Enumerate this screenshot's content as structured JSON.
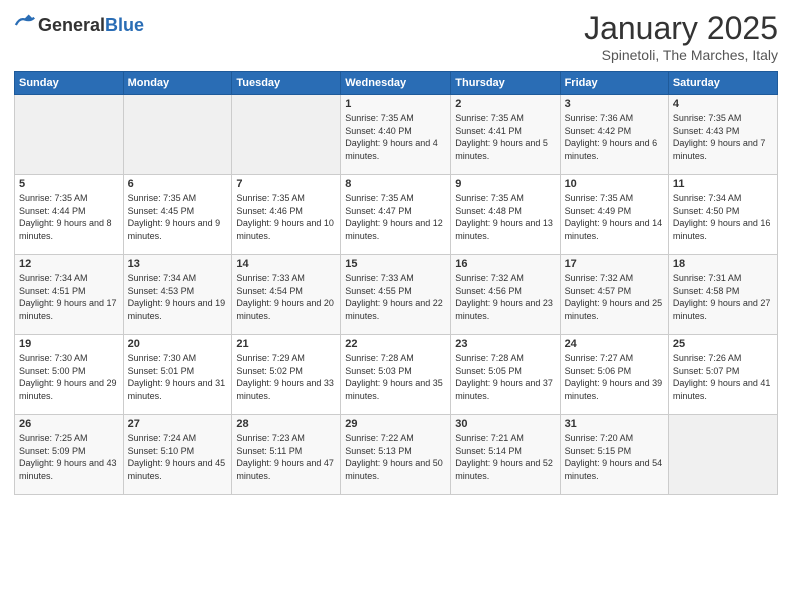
{
  "logo": {
    "general": "General",
    "blue": "Blue"
  },
  "title": "January 2025",
  "subtitle": "Spinetoli, The Marches, Italy",
  "days_of_week": [
    "Sunday",
    "Monday",
    "Tuesday",
    "Wednesday",
    "Thursday",
    "Friday",
    "Saturday"
  ],
  "weeks": [
    [
      {
        "day": "",
        "info": ""
      },
      {
        "day": "",
        "info": ""
      },
      {
        "day": "",
        "info": ""
      },
      {
        "day": "1",
        "info": "Sunrise: 7:35 AM\nSunset: 4:40 PM\nDaylight: 9 hours and 4 minutes."
      },
      {
        "day": "2",
        "info": "Sunrise: 7:35 AM\nSunset: 4:41 PM\nDaylight: 9 hours and 5 minutes."
      },
      {
        "day": "3",
        "info": "Sunrise: 7:36 AM\nSunset: 4:42 PM\nDaylight: 9 hours and 6 minutes."
      },
      {
        "day": "4",
        "info": "Sunrise: 7:35 AM\nSunset: 4:43 PM\nDaylight: 9 hours and 7 minutes."
      }
    ],
    [
      {
        "day": "5",
        "info": "Sunrise: 7:35 AM\nSunset: 4:44 PM\nDaylight: 9 hours and 8 minutes."
      },
      {
        "day": "6",
        "info": "Sunrise: 7:35 AM\nSunset: 4:45 PM\nDaylight: 9 hours and 9 minutes."
      },
      {
        "day": "7",
        "info": "Sunrise: 7:35 AM\nSunset: 4:46 PM\nDaylight: 9 hours and 10 minutes."
      },
      {
        "day": "8",
        "info": "Sunrise: 7:35 AM\nSunset: 4:47 PM\nDaylight: 9 hours and 12 minutes."
      },
      {
        "day": "9",
        "info": "Sunrise: 7:35 AM\nSunset: 4:48 PM\nDaylight: 9 hours and 13 minutes."
      },
      {
        "day": "10",
        "info": "Sunrise: 7:35 AM\nSunset: 4:49 PM\nDaylight: 9 hours and 14 minutes."
      },
      {
        "day": "11",
        "info": "Sunrise: 7:34 AM\nSunset: 4:50 PM\nDaylight: 9 hours and 16 minutes."
      }
    ],
    [
      {
        "day": "12",
        "info": "Sunrise: 7:34 AM\nSunset: 4:51 PM\nDaylight: 9 hours and 17 minutes."
      },
      {
        "day": "13",
        "info": "Sunrise: 7:34 AM\nSunset: 4:53 PM\nDaylight: 9 hours and 19 minutes."
      },
      {
        "day": "14",
        "info": "Sunrise: 7:33 AM\nSunset: 4:54 PM\nDaylight: 9 hours and 20 minutes."
      },
      {
        "day": "15",
        "info": "Sunrise: 7:33 AM\nSunset: 4:55 PM\nDaylight: 9 hours and 22 minutes."
      },
      {
        "day": "16",
        "info": "Sunrise: 7:32 AM\nSunset: 4:56 PM\nDaylight: 9 hours and 23 minutes."
      },
      {
        "day": "17",
        "info": "Sunrise: 7:32 AM\nSunset: 4:57 PM\nDaylight: 9 hours and 25 minutes."
      },
      {
        "day": "18",
        "info": "Sunrise: 7:31 AM\nSunset: 4:58 PM\nDaylight: 9 hours and 27 minutes."
      }
    ],
    [
      {
        "day": "19",
        "info": "Sunrise: 7:30 AM\nSunset: 5:00 PM\nDaylight: 9 hours and 29 minutes."
      },
      {
        "day": "20",
        "info": "Sunrise: 7:30 AM\nSunset: 5:01 PM\nDaylight: 9 hours and 31 minutes."
      },
      {
        "day": "21",
        "info": "Sunrise: 7:29 AM\nSunset: 5:02 PM\nDaylight: 9 hours and 33 minutes."
      },
      {
        "day": "22",
        "info": "Sunrise: 7:28 AM\nSunset: 5:03 PM\nDaylight: 9 hours and 35 minutes."
      },
      {
        "day": "23",
        "info": "Sunrise: 7:28 AM\nSunset: 5:05 PM\nDaylight: 9 hours and 37 minutes."
      },
      {
        "day": "24",
        "info": "Sunrise: 7:27 AM\nSunset: 5:06 PM\nDaylight: 9 hours and 39 minutes."
      },
      {
        "day": "25",
        "info": "Sunrise: 7:26 AM\nSunset: 5:07 PM\nDaylight: 9 hours and 41 minutes."
      }
    ],
    [
      {
        "day": "26",
        "info": "Sunrise: 7:25 AM\nSunset: 5:09 PM\nDaylight: 9 hours and 43 minutes."
      },
      {
        "day": "27",
        "info": "Sunrise: 7:24 AM\nSunset: 5:10 PM\nDaylight: 9 hours and 45 minutes."
      },
      {
        "day": "28",
        "info": "Sunrise: 7:23 AM\nSunset: 5:11 PM\nDaylight: 9 hours and 47 minutes."
      },
      {
        "day": "29",
        "info": "Sunrise: 7:22 AM\nSunset: 5:13 PM\nDaylight: 9 hours and 50 minutes."
      },
      {
        "day": "30",
        "info": "Sunrise: 7:21 AM\nSunset: 5:14 PM\nDaylight: 9 hours and 52 minutes."
      },
      {
        "day": "31",
        "info": "Sunrise: 7:20 AM\nSunset: 5:15 PM\nDaylight: 9 hours and 54 minutes."
      },
      {
        "day": "",
        "info": ""
      }
    ]
  ]
}
